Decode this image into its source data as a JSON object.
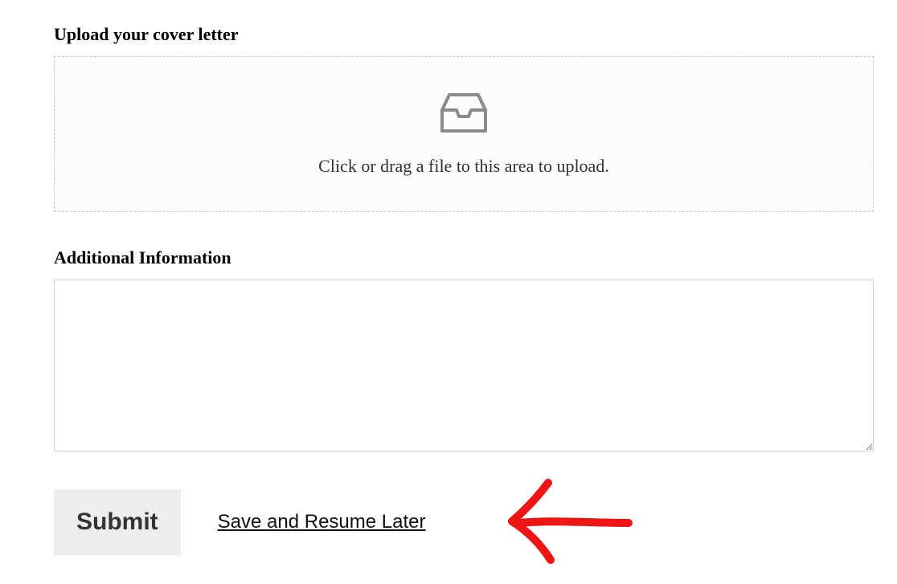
{
  "upload": {
    "label": "Upload your cover letter",
    "hint": "Click or drag a file to this area to upload."
  },
  "additional": {
    "label": "Additional Information",
    "value": ""
  },
  "actions": {
    "submit_label": "Submit",
    "save_resume_label": "Save and Resume Later"
  }
}
